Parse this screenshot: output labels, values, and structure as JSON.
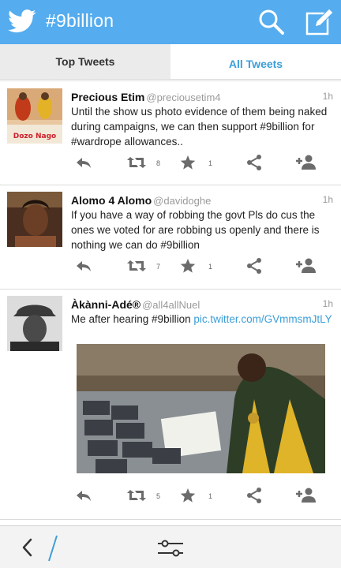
{
  "header": {
    "title": "#9billion",
    "icons": {
      "logo": "twitter-bird-icon",
      "search": "search-icon",
      "compose": "compose-icon"
    },
    "color": "#55acee"
  },
  "tabs": [
    {
      "label": "Top Tweets",
      "active": false
    },
    {
      "label": "All Tweets",
      "active": true
    }
  ],
  "tweets": [
    {
      "name": "Precious Etim",
      "handle": "@preciousetim4",
      "time": "1h",
      "avatar_text": "Dozo Nago",
      "text": "Until the show us photo evidence of them being naked during campaigns, we can then support #9billion for #wardrope allowances..",
      "retweets": "8",
      "favorites": "1"
    },
    {
      "name": "Alomo 4 Alomo",
      "handle": "@davidoghe",
      "time": "1h",
      "text": "If you have a way of robbing the govt Pls do cus the ones we voted for are robbing us openly and there is nothing we can do #9billion",
      "retweets": "7",
      "favorites": "1"
    },
    {
      "name": "Àkànni-Adé®",
      "handle": "@all4allNuel",
      "time": "1h",
      "text": "Me after hearing #9billion ",
      "link": "pic.twitter.com/GVmmsmJtLY",
      "retweets": "5",
      "favorites": "1"
    }
  ],
  "bottom_bar": {
    "icons": [
      "back-icon",
      "filter-icon"
    ]
  },
  "colors": {
    "accent": "#3b9ed8",
    "icon": "#6b6b6b"
  }
}
